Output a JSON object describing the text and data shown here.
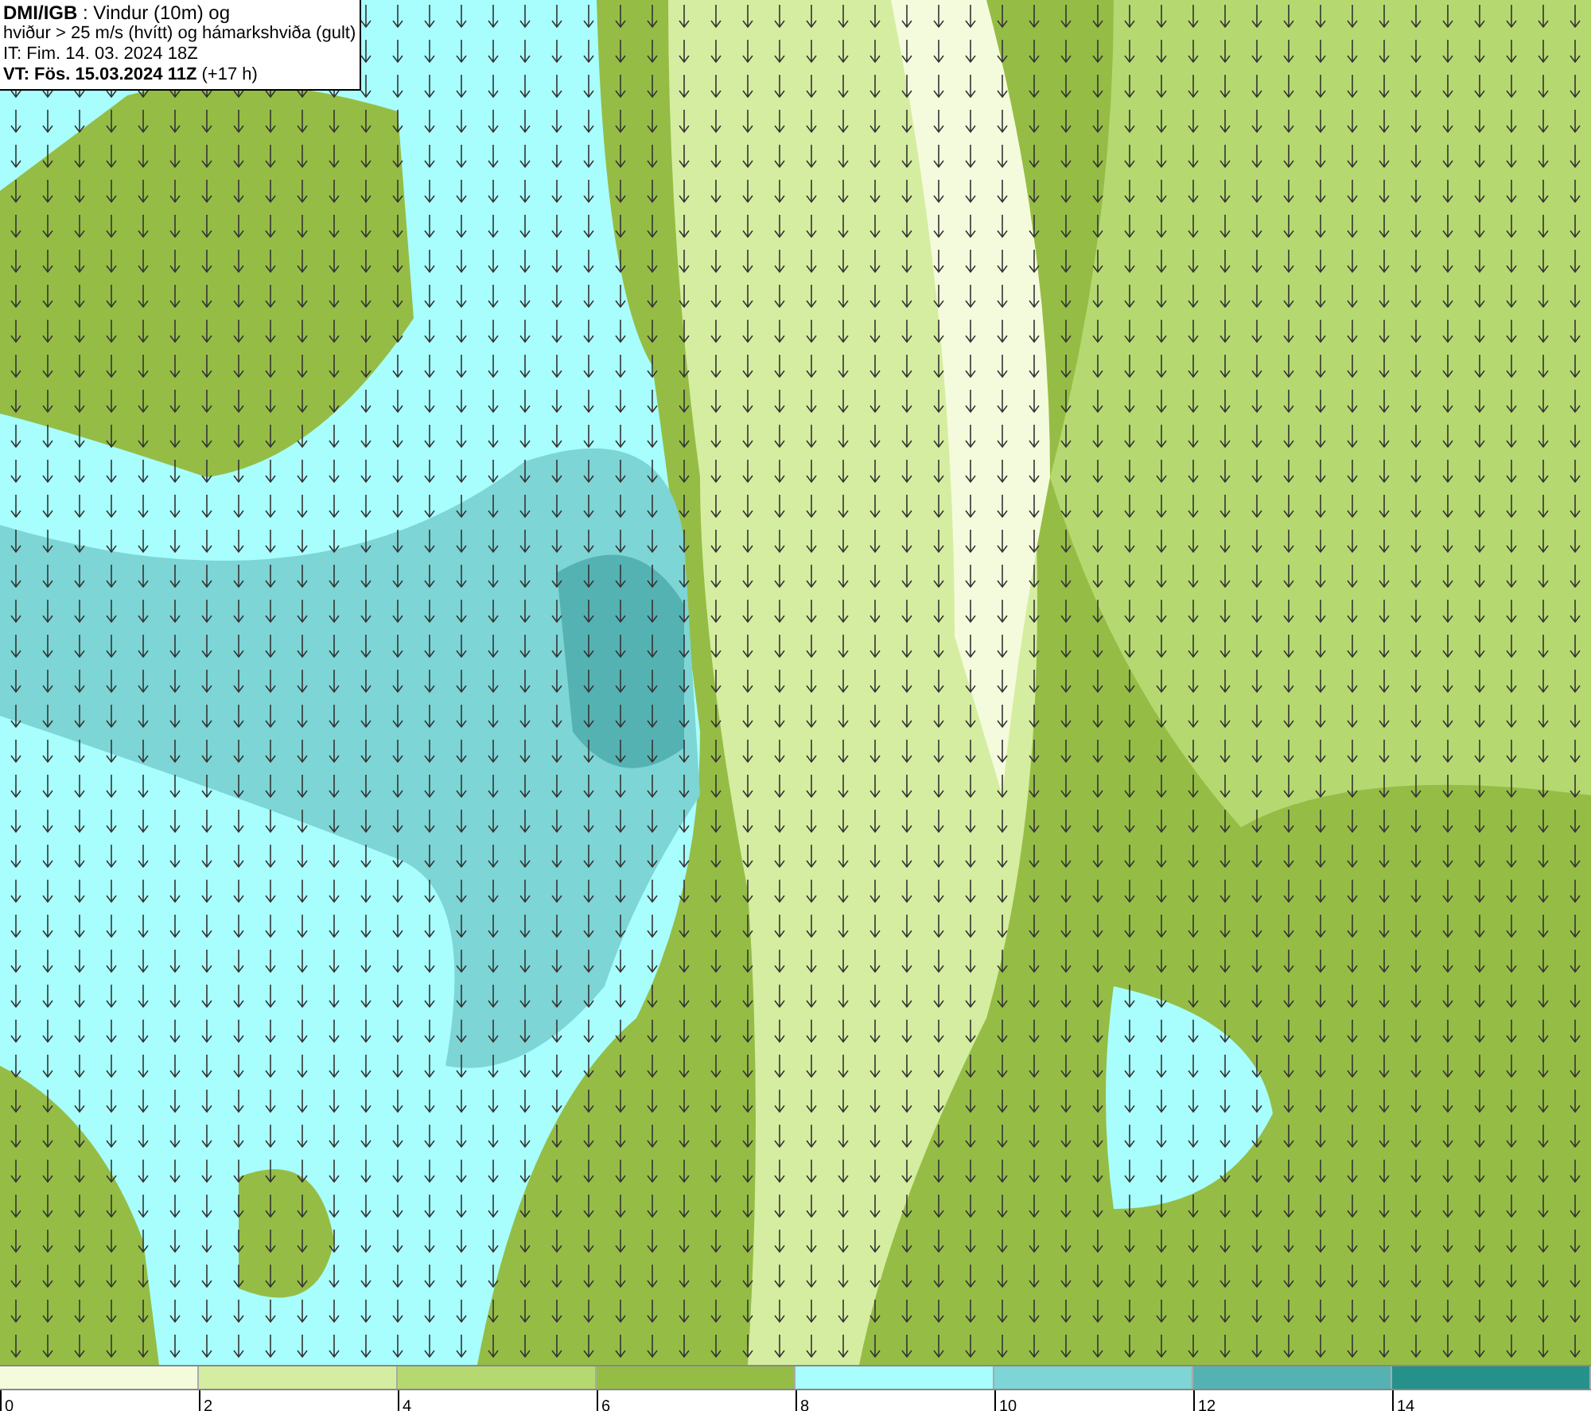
{
  "info_box": {
    "lines": [
      "**DMI/IGB** : Vindur (10m) og",
      "hviður > 25 m/s (hvítt) og hámarkshviða (gult)",
      "IT: Fim. 14. 03. 2024 18Z",
      "**VT: Fös. 15.03.2024 11Z** (+17 h)"
    ]
  },
  "colorbar": {
    "bins": [
      {
        "color": "#f4fbdc"
      },
      {
        "color": "#d5eda0"
      },
      {
        "color": "#b5d970"
      },
      {
        "color": "#95bd45"
      },
      {
        "color": "#a8fdfd"
      },
      {
        "color": "#7dd5d5"
      },
      {
        "color": "#55b2b2"
      },
      {
        "color": "#25918a"
      }
    ],
    "ticks": [
      "0",
      "2",
      "4",
      "6",
      "8",
      "10",
      "12",
      "14"
    ]
  }
}
